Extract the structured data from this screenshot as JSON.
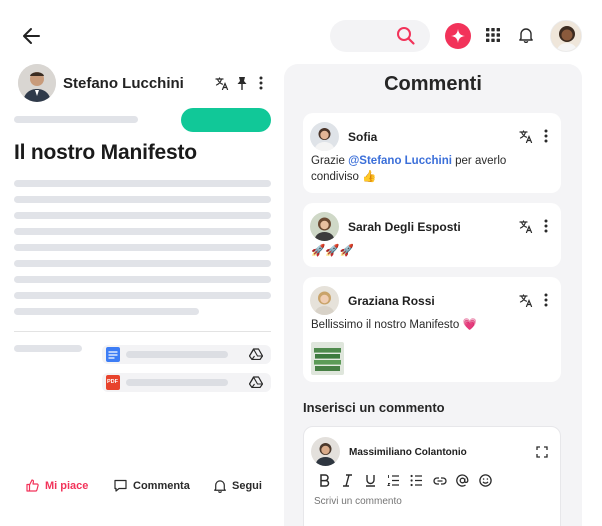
{
  "header": {
    "search": {
      "placeholder": ""
    },
    "colors": {
      "accent": "#f2335a",
      "primary": "#11c898",
      "mention": "#3b6fd9"
    }
  },
  "article": {
    "author": "Stefano Lucchini",
    "title": "Il nostro Manifesto",
    "attachments": [
      {
        "type": "google-doc",
        "icon": "doc-icon"
      },
      {
        "type": "pdf",
        "icon": "pdf-icon",
        "badge": "PDF"
      }
    ],
    "actions": {
      "like": "Mi piace",
      "comment": "Commenta",
      "follow": "Segui"
    }
  },
  "comments": {
    "title": "Commenti",
    "items": [
      {
        "author": "Sofia",
        "text_before": "Grazie ",
        "mention": "@Stefano Lucchini",
        "text_after": " per averlo condiviso 👍"
      },
      {
        "author": "Sarah Degli Esposti",
        "text": "🚀🚀🚀"
      },
      {
        "author": "Graziana Rossi",
        "text": "Bellissimo il nostro Manifesto 💗"
      }
    ],
    "composer": {
      "label": "Inserisci un commento",
      "user": "Massimiliano Colantonio",
      "placeholder": "Scrivi un commento"
    }
  }
}
